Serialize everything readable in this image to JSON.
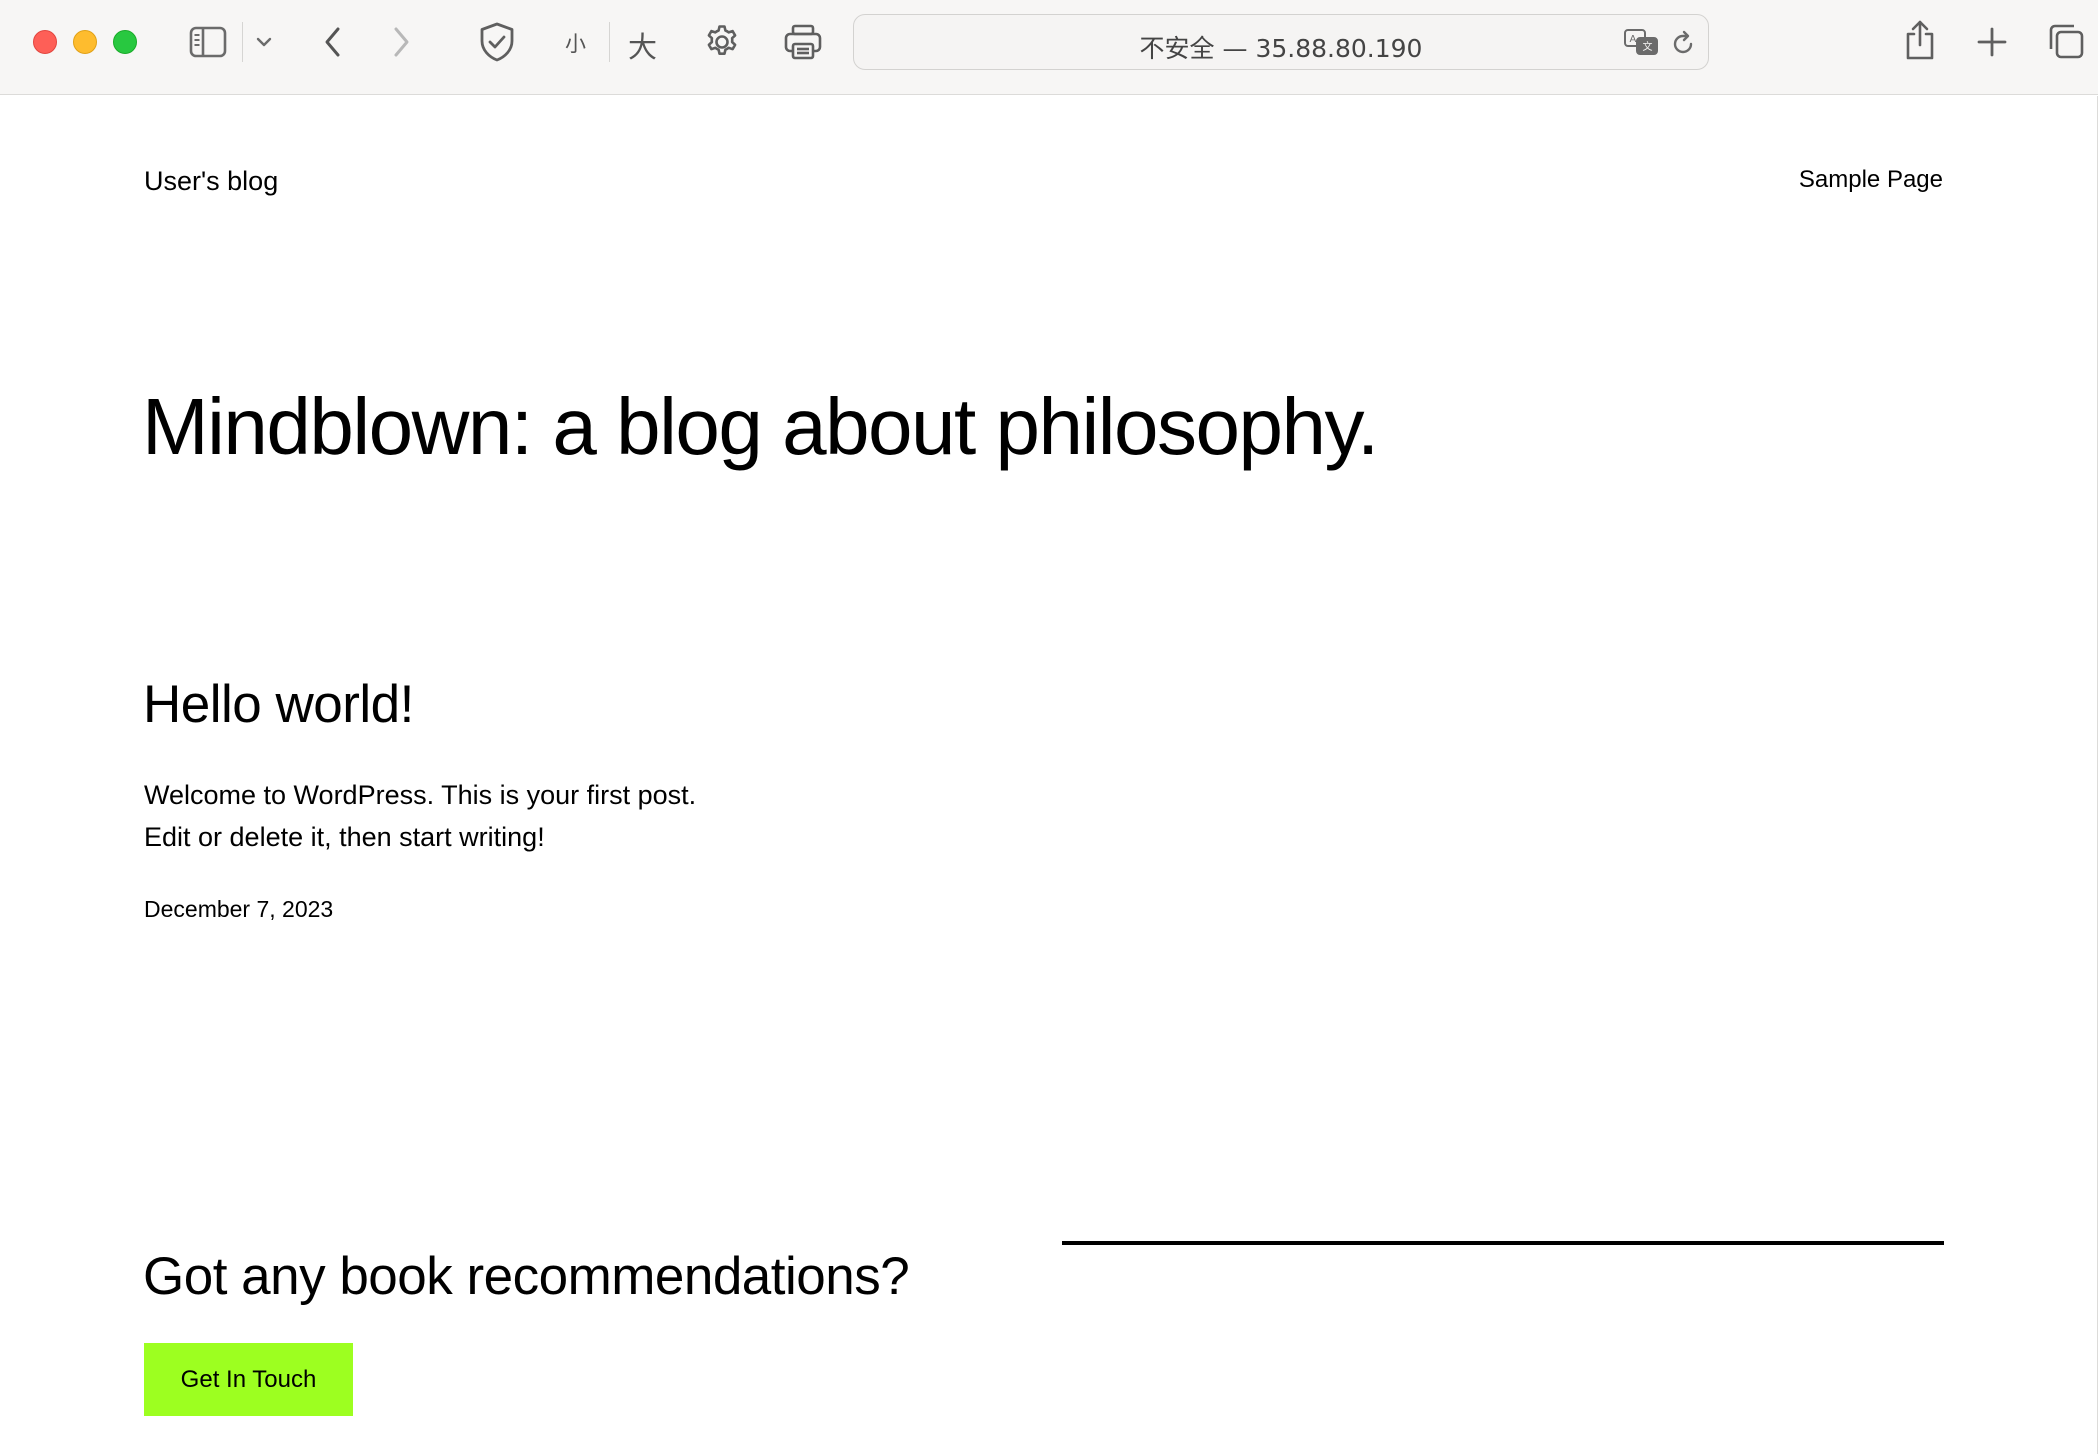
{
  "browser": {
    "font_small_label": "小",
    "font_large_label": "大",
    "address": "不安全 — 35.88.80.190",
    "icons": {
      "sidebar": "sidebar-icon",
      "tab_overview_menu": "chevron-down-icon",
      "back": "chevron-left-icon",
      "forward": "chevron-right-icon",
      "privacy": "shield-check-icon",
      "settings": "gear-icon",
      "print": "printer-icon",
      "translate": "translate-icon",
      "reload": "reload-icon",
      "share": "share-icon",
      "new_tab": "plus-icon",
      "tabs": "tabs-overview-icon"
    },
    "colors": {
      "close": "#fe5f57",
      "minimize": "#febc2e",
      "zoom": "#28c840"
    }
  },
  "site": {
    "title": "User's blog",
    "nav": {
      "sample_page": "Sample Page"
    }
  },
  "hero": {
    "title": "Mindblown: a blog about philosophy."
  },
  "post": {
    "title": "Hello world!",
    "excerpt_line1": "Welcome to WordPress. This is your first post.",
    "excerpt_line2": "Edit or delete it, then start writing!",
    "date": "December 7, 2023"
  },
  "cta": {
    "title": "Got any book recommendations?",
    "button_label": "Get In Touch",
    "button_color": "#9dff20"
  }
}
